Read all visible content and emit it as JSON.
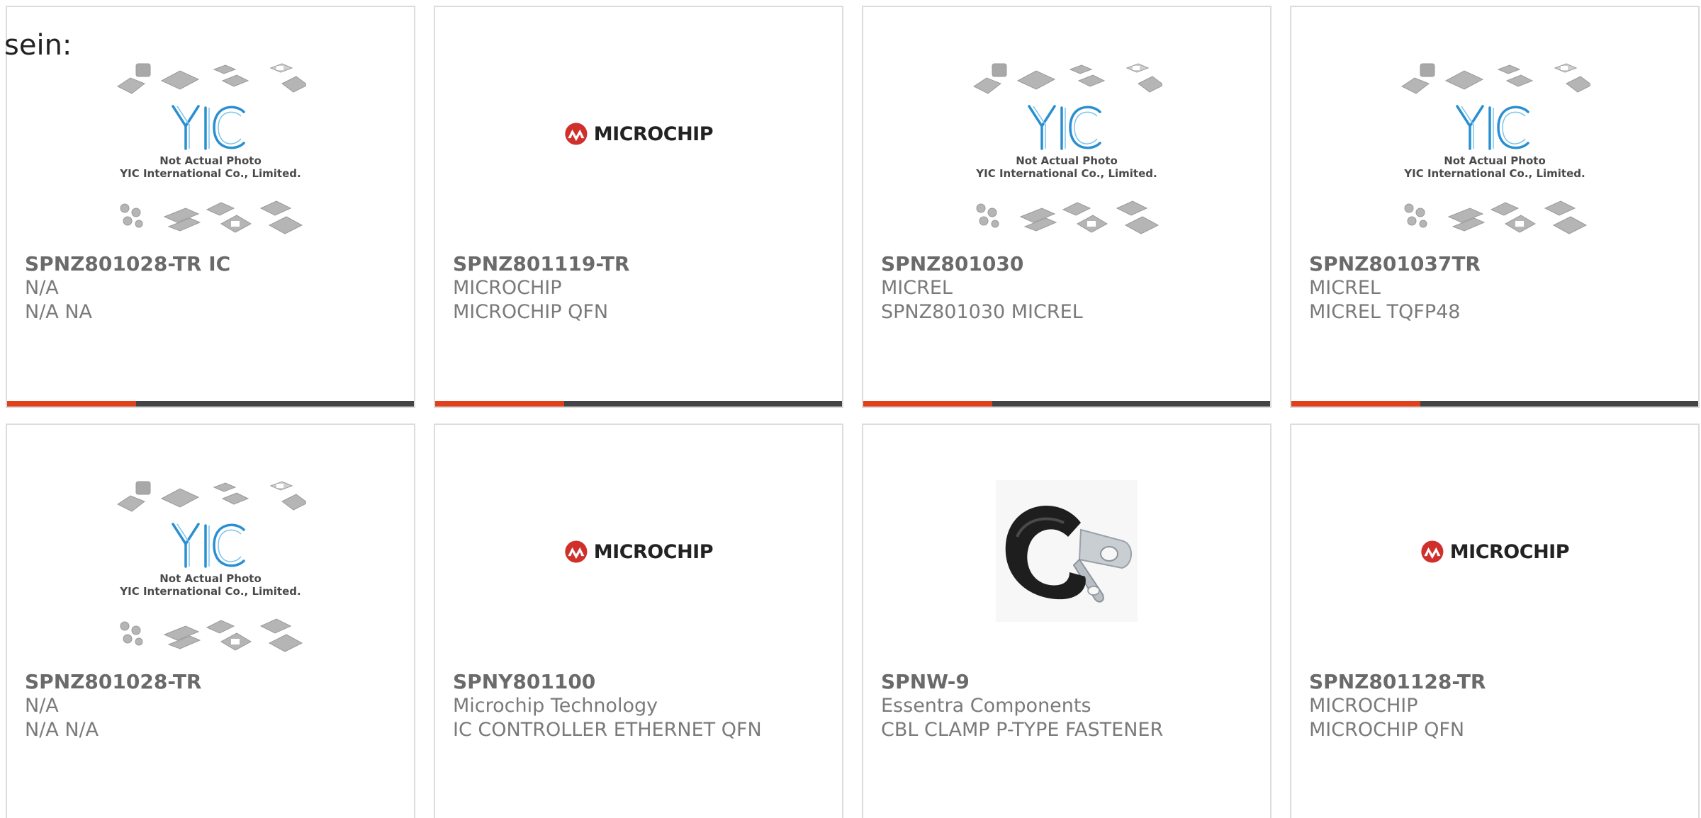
{
  "stray_text": "sein:",
  "colors": {
    "accent": "#e0401a",
    "bar": "#444444",
    "border": "#dcdcdc",
    "title": "#6a6a6a",
    "text": "#7a7a7a",
    "microchip_red": "#d0302b",
    "yic_blue": "#2a8fd0"
  },
  "placeholder": {
    "logo_text": "YIC",
    "caption_line1": "Not Actual Photo",
    "caption_line2": "YIC International Co., Limited."
  },
  "microchip_logo_text": "MICROCHIP",
  "products": [
    {
      "part": "SPNZ801028-TR IC",
      "manufacturer": "N/A",
      "description": "N/A NA",
      "image": "yic-placeholder"
    },
    {
      "part": "SPNZ801119-TR",
      "manufacturer": "MICROCHIP",
      "description": "MICROCHIP QFN",
      "image": "microchip-logo"
    },
    {
      "part": "SPNZ801030",
      "manufacturer": "MICREL",
      "description": "SPNZ801030 MICREL",
      "image": "yic-placeholder"
    },
    {
      "part": "SPNZ801037TR",
      "manufacturer": "MICREL",
      "description": "MICREL TQFP48",
      "image": "yic-placeholder"
    },
    {
      "part": "SPNZ801028-TR",
      "manufacturer": "N/A",
      "description": "N/A N/A",
      "image": "yic-placeholder"
    },
    {
      "part": "SPNY801100",
      "manufacturer": "Microchip Technology",
      "description": "IC CONTROLLER ETHERNET QFN",
      "image": "microchip-logo"
    },
    {
      "part": "SPNW-9",
      "manufacturer": "Essentra Components",
      "description": "CBL CLAMP P-TYPE FASTENER",
      "image": "cable-clamp-photo"
    },
    {
      "part": "SPNZ801128-TR",
      "manufacturer": "MICROCHIP",
      "description": "MICROCHIP QFN",
      "image": "microchip-logo"
    }
  ]
}
